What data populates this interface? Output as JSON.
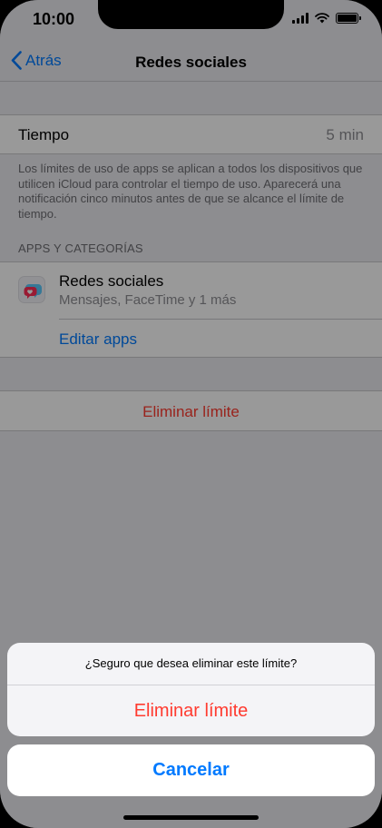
{
  "status_bar": {
    "time": "10:00"
  },
  "nav": {
    "back_label": "Atrás",
    "title": "Redes sociales"
  },
  "time_row": {
    "label": "Tiempo",
    "value": "5 min"
  },
  "footnote": "Los límites de uso de apps se aplican a todos los dispositivos que utilicen iCloud para controlar el tiempo de uso. Aparecerá una notificación cinco minutos antes de que se alcance el límite de tiempo.",
  "apps_section": {
    "header": "APPS Y CATEGORÍAS",
    "app_name": "Redes sociales",
    "app_subtitle": "Mensajes, FaceTime y 1 más",
    "edit_label": "Editar apps"
  },
  "remove_row": {
    "label": "Eliminar límite"
  },
  "action_sheet": {
    "message": "¿Seguro que desea eliminar este límite?",
    "destructive_label": "Eliminar límite",
    "cancel_label": "Cancelar"
  },
  "colors": {
    "accent": "#007aff",
    "destructive": "#ff3b30",
    "secondary_text": "#8e8e93",
    "grouped_background": "#ebebf0"
  },
  "icons": {
    "back": "chevron-left-icon",
    "app_category": "social-chat-heart-icon",
    "signal": "cellular-signal-icon",
    "wifi": "wifi-icon",
    "battery": "battery-icon"
  }
}
